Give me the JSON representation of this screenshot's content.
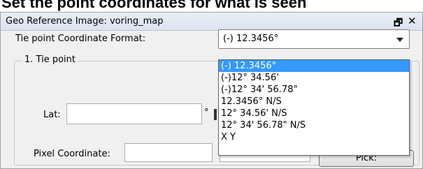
{
  "top_banner": {
    "text": "Set the point coordinates for what is seen"
  },
  "dialog": {
    "title": "Geo Reference Image: voring_map",
    "float_icon": "float-icon",
    "close_icon": "close-icon"
  },
  "format": {
    "label": "Tie point Coordinate Format:",
    "selected": "(-) 12.3456°",
    "options": [
      "(-) 12.3456°",
      "(-)12° 34.56'",
      "(-)12° 34' 56.78\"",
      "12.3456° N/S",
      "12° 34.56' N/S",
      "12° 34' 56.78\" N/S",
      "X Y"
    ],
    "highlighted_index": 0
  },
  "tie_point": {
    "group_title": "1. Tie point",
    "lat_label": "Lat:",
    "lat_value": "",
    "lat_unit": "°",
    "pixel_label": "Pixel Coordinate:",
    "pixel_x": "",
    "pixel_y": "",
    "pick_label": "Pick:"
  },
  "colors": {
    "panel_bg": "#f0f0f0",
    "selection": "#3399ff"
  }
}
